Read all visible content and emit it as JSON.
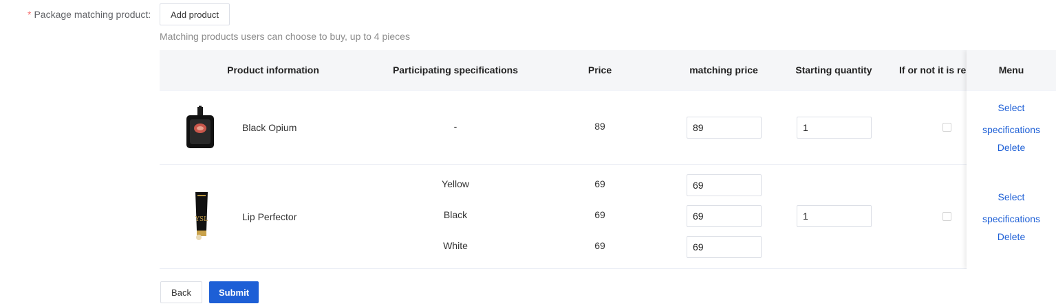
{
  "form": {
    "required_mark": "*",
    "label": "Package matching product:",
    "add_button": "Add product",
    "hint": "Matching products users can choose to buy, up to 4 pieces"
  },
  "table": {
    "headers": {
      "product_info": "Product information",
      "specs": "Participating specifications",
      "price": "Price",
      "matching_price": "matching price",
      "starting_quantity": "Starting quantity",
      "required": "If or not it is re",
      "menu": "Menu"
    },
    "rows": [
      {
        "name": "Black Opium",
        "specs": [
          {
            "spec": "-",
            "price": "89",
            "matching_price": "89"
          }
        ],
        "starting_quantity": "1",
        "required": false,
        "actions": {
          "select": "Select",
          "specifications": "specifications",
          "delete": "Delete"
        }
      },
      {
        "name": "Lip Perfector",
        "specs": [
          {
            "spec": "Yellow",
            "price": "69",
            "matching_price": "69"
          },
          {
            "spec": "Black",
            "price": "69",
            "matching_price": "69"
          },
          {
            "spec": "White",
            "price": "69",
            "matching_price": "69"
          }
        ],
        "starting_quantity": "1",
        "required": false,
        "actions": {
          "select": "Select",
          "specifications": "specifications",
          "delete": "Delete"
        }
      }
    ]
  },
  "footer": {
    "back": "Back",
    "submit": "Submit"
  },
  "colors": {
    "primary": "#1d5fd6",
    "required": "#f56c6c",
    "header_bg": "#f5f6f8"
  }
}
